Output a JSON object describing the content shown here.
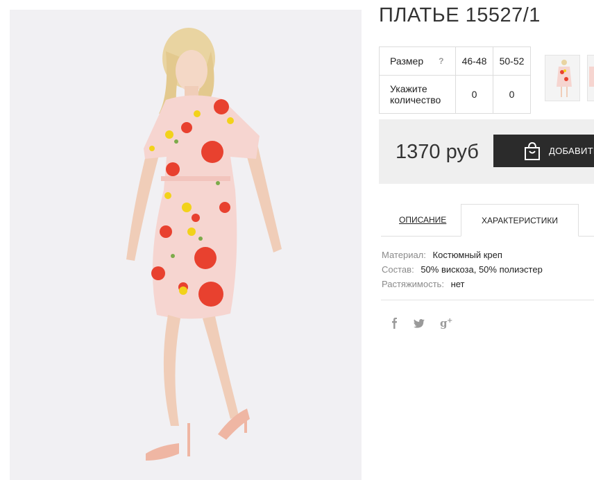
{
  "product": {
    "title": "ПЛАТЬЕ 15527/1",
    "image_alt_icon": "product-photo"
  },
  "sizes": {
    "size_label": "Размер",
    "hint_label": "?",
    "quantity_label": "Укажите количество",
    "options": [
      {
        "size": "46-48",
        "quantity": "0"
      },
      {
        "size": "50-52",
        "quantity": "0"
      }
    ]
  },
  "purchase": {
    "price": "1370 руб",
    "button_label": "ДОБАВИТЬ",
    "button_icon": "shopping-bag-icon"
  },
  "tabs": [
    {
      "label": "ОПИСАНИЕ",
      "active": false
    },
    {
      "label": "ХАРАКТЕРИСТИКИ",
      "active": true
    }
  ],
  "characteristics": [
    {
      "key": "Материал:",
      "value": "Костюмный креп"
    },
    {
      "key": "Состав:",
      "value": "50% вискоза, 50% полиэстер"
    },
    {
      "key": "Растяжимость:",
      "value": "нет"
    }
  ],
  "social": [
    {
      "icon": "facebook-icon",
      "glyph": "f"
    },
    {
      "icon": "twitter-icon",
      "glyph": "🐦"
    },
    {
      "icon": "google-plus-icon",
      "glyph": "g+"
    }
  ],
  "colors": {
    "dark_button": "#2b2b2b",
    "price_bg": "#efefef",
    "dress_base": "#f6d5d0",
    "flower_red": "#e8412f",
    "flower_yellow": "#f2d21a"
  }
}
